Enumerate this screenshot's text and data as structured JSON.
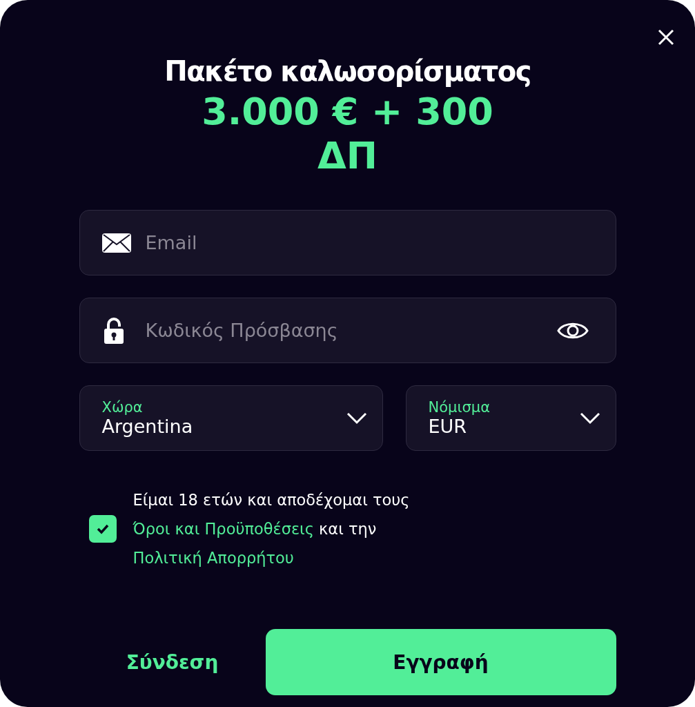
{
  "title": "Πακέτο καλωσορίσματος",
  "bonus": "3.000 € + 300 ΔΠ",
  "email": {
    "placeholder": "Email"
  },
  "password": {
    "placeholder": "Κωδικός Πρόσβασης"
  },
  "selects": [
    {
      "label": "Χώρα",
      "value": "Argentina"
    },
    {
      "label": "Νόμισμα",
      "value": "EUR"
    }
  ],
  "terms": {
    "checked": true,
    "text_before": "Είμαι 18 ετών και αποδέχομαι τους",
    "link_1": "Όροι και Προϋποθέσεις",
    "text_middle": "και την",
    "link_2": "Πολιτική Απορρήτου"
  },
  "login": "Σύνδεση",
  "register": "Εγγραφή"
}
